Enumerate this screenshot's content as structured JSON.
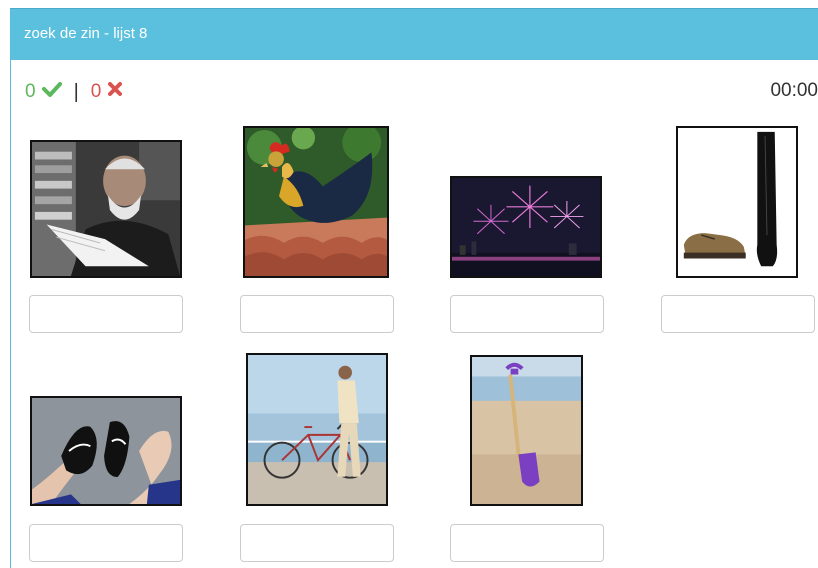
{
  "header": {
    "title": "zoek de zin - lijst 8"
  },
  "score": {
    "correct": "0",
    "separator": "|",
    "wrong": "0"
  },
  "timer": "00:00",
  "colors": {
    "header": "#5bc0de",
    "correct": "#5cb85c",
    "wrong": "#d9534f"
  },
  "images": [
    {
      "subject": "old man reading a book"
    },
    {
      "subject": "rooster"
    },
    {
      "subject": "fireworks"
    },
    {
      "subject": "boot and shoe"
    },
    {
      "subject": "feet with sneakers"
    },
    {
      "subject": "man walking with bicycle"
    },
    {
      "subject": "spade in the sand"
    }
  ],
  "answers": [
    {
      "value": ""
    },
    {
      "value": ""
    },
    {
      "value": ""
    },
    {
      "value": ""
    },
    {
      "value": ""
    },
    {
      "value": ""
    },
    {
      "value": ""
    }
  ]
}
